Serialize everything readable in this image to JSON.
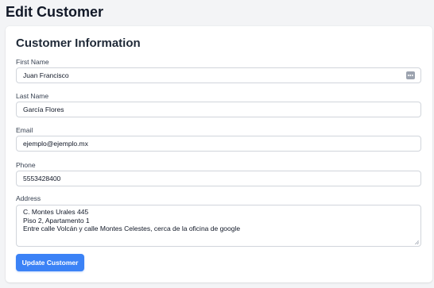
{
  "page": {
    "title": "Edit Customer"
  },
  "card": {
    "title": "Customer Information"
  },
  "fields": {
    "first_name": {
      "label": "First Name",
      "value": "Juan Francisco"
    },
    "last_name": {
      "label": "Last Name",
      "value": "García Flores"
    },
    "email": {
      "label": "Email",
      "value": "ejemplo@ejemplo.mx"
    },
    "phone": {
      "label": "Phone",
      "value": "5553428400"
    },
    "address": {
      "label": "Address",
      "lines": [
        "C. Montes Urales 445",
        "Piso 2, Apartamento 1",
        "Entre calle Volcán y calle Montes Celestes, cerca de la oficina de google"
      ]
    }
  },
  "actions": {
    "submit_label": "Update Customer"
  },
  "colors": {
    "accent": "#3b82f6",
    "background": "#f3f4f6",
    "card": "#ffffff",
    "border": "#d1d5db"
  },
  "icons": {
    "autofill": "password-manager-autofill-icon"
  }
}
